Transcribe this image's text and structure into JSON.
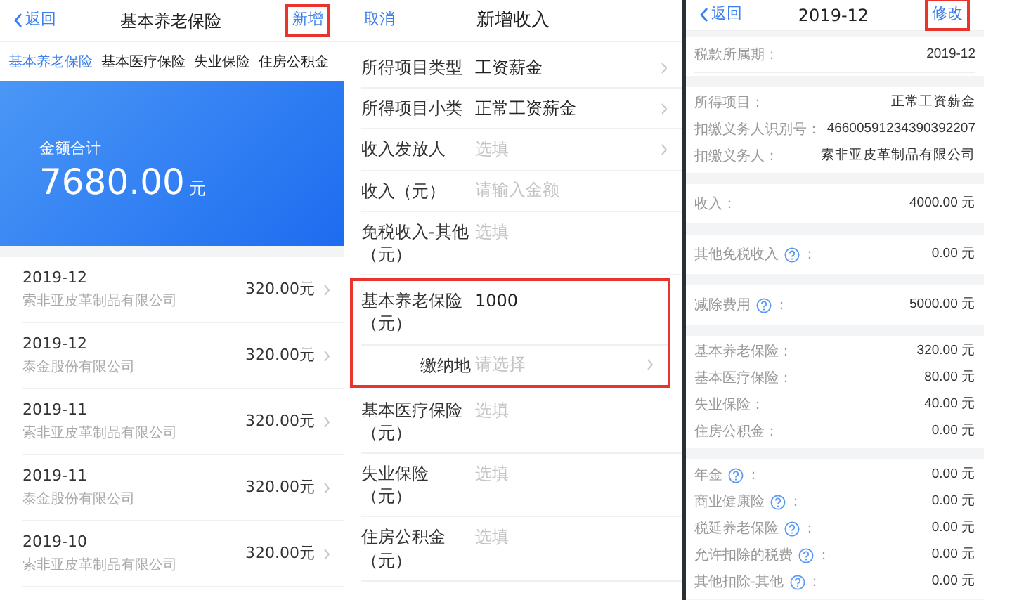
{
  "list_screen": {
    "back": "返回",
    "title": "基本养老保险",
    "action": {
      "label": "新增",
      "highlighted": true
    },
    "tabs": [
      {
        "label": "基本养老保险",
        "selected": true
      },
      {
        "label": "基本医疗保险",
        "selected": false
      },
      {
        "label": "失业保险",
        "selected": false
      },
      {
        "label": "住房公积金",
        "selected": false
      }
    ],
    "summary": {
      "label": "金额合计",
      "amount": "7680.00",
      "unit": "元"
    },
    "records": [
      {
        "date": "2019-12",
        "company": "索非亚皮革制品有限公司",
        "amount": "320.00元"
      },
      {
        "date": "2019-12",
        "company": "泰金股份有限公司",
        "amount": "320.00元"
      },
      {
        "date": "2019-11",
        "company": "索非亚皮革制品有限公司",
        "amount": "320.00元"
      },
      {
        "date": "2019-11",
        "company": "泰金股份有限公司",
        "amount": "320.00元"
      },
      {
        "date": "2019-10",
        "company": "索非亚皮革制品有限公司",
        "amount": "320.00元"
      }
    ]
  },
  "form_screen": {
    "cancel": "取消",
    "title": "新增收入",
    "rows": [
      {
        "kind": "main",
        "label": "所得项目类型",
        "value": "工资薪金",
        "chevron": true
      },
      {
        "kind": "main",
        "label": "所得项目小类",
        "value": "正常工资薪金",
        "chevron": true
      },
      {
        "kind": "main",
        "label": "收入发放人",
        "placeholder": "选填",
        "chevron": true
      },
      {
        "kind": "main",
        "label": "收入（元）",
        "placeholder": "请输入金额",
        "chevron": false
      },
      {
        "kind": "main",
        "label": "免税收入-其他（元）",
        "placeholder": "选填",
        "chevron": false
      },
      {
        "kind": "highlight_group",
        "rows": [
          {
            "kind": "main",
            "label": "基本养老保险（元）",
            "value": "1000",
            "chevron": false
          },
          {
            "kind": "sub",
            "label": "缴纳地",
            "placeholder": "请选择",
            "chevron": true
          }
        ]
      },
      {
        "kind": "main",
        "label": "基本医疗保险（元）",
        "placeholder": "选填",
        "chevron": false
      },
      {
        "kind": "main",
        "label": "失业保险（元）",
        "placeholder": "选填",
        "chevron": false
      },
      {
        "kind": "main",
        "label": "住房公积金（元）",
        "placeholder": "选填",
        "chevron": false
      }
    ]
  },
  "detail_screen": {
    "back": "返回",
    "title": "2019-12",
    "action": {
      "label": "修改",
      "highlighted": true
    },
    "sections": [
      [
        {
          "label": "税款所属期",
          "suffix": "：",
          "value": "2019-12",
          "help": false,
          "divider": true
        }
      ],
      [
        {
          "label": "所得项目",
          "suffix": "：",
          "value": "正常工资薪金",
          "help": false,
          "divider": false
        },
        {
          "label": "扣缴义务人识别号",
          "suffix": "：",
          "value": "46600591234390392207",
          "help": false,
          "divider": false
        },
        {
          "label": "扣缴义务人",
          "suffix": "：",
          "value": "索非亚皮革制品有限公司",
          "help": false,
          "divider": false
        }
      ],
      [
        {
          "label": "收入",
          "suffix": "：",
          "value": "4000.00 元",
          "help": false,
          "divider": false
        }
      ],
      [
        {
          "label": "其他免税收入",
          "suffix": "：",
          "value": "0.00 元",
          "help": true,
          "divider": false
        }
      ],
      [
        {
          "label": "减除费用",
          "suffix": "：",
          "value": "5000.00 元",
          "help": true,
          "divider": false
        }
      ],
      [
        {
          "label": "基本养老保险",
          "suffix": "：",
          "value": "320.00 元",
          "help": false,
          "divider": false
        },
        {
          "label": "基本医疗保险",
          "suffix": "：",
          "value": "80.00 元",
          "help": false,
          "divider": false
        },
        {
          "label": "失业保险",
          "suffix": "：",
          "value": "40.00 元",
          "help": false,
          "divider": false
        },
        {
          "label": "住房公积金",
          "suffix": "：",
          "value": "0.00 元",
          "help": false,
          "divider": false
        }
      ],
      [
        {
          "label": "年金",
          "suffix": "：",
          "value": "0.00 元",
          "help": true,
          "divider": false
        },
        {
          "label": "商业健康险",
          "suffix": "：",
          "value": "0.00 元",
          "help": true,
          "divider": false
        },
        {
          "label": "税延养老保险",
          "suffix": "：",
          "value": "0.00 元",
          "help": true,
          "divider": false
        },
        {
          "label": "允许扣除的税费",
          "suffix": "：",
          "value": "0.00 元",
          "help": true,
          "divider": false
        },
        {
          "label": "其他扣除-其他",
          "suffix": "：",
          "value": "0.00 元",
          "help": true,
          "divider": false
        }
      ]
    ]
  }
}
